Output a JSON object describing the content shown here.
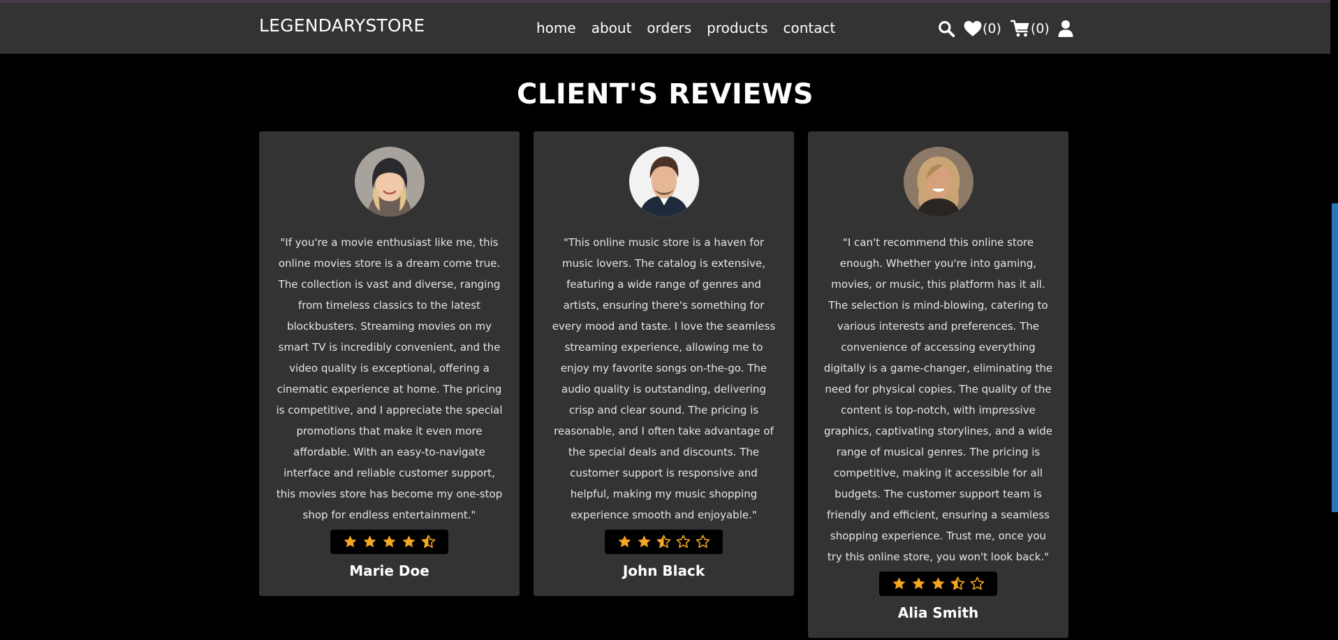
{
  "header": {
    "logo": "LEGENDARYSTORE",
    "nav": [
      {
        "label": "home"
      },
      {
        "label": "about"
      },
      {
        "label": "orders"
      },
      {
        "label": "products"
      },
      {
        "label": "contact"
      }
    ],
    "wishlist_count": "(0)",
    "cart_count": "(0)",
    "icons": [
      "search-icon",
      "heart-icon",
      "cart-icon",
      "user-icon"
    ]
  },
  "section": {
    "title": "CLIENT'S REVIEWS"
  },
  "colors": {
    "background": "#000000",
    "header_bg": "#333333",
    "card_bg": "#333333",
    "star": "#f5a623",
    "scroll_accent": "#2a77b8"
  },
  "reviews": [
    {
      "text": "\"If you're a movie enthusiast like me, this online movies store is a dream come true. The collection is vast and diverse, ranging from timeless classics to the latest blockbusters. Streaming movies on my smart TV is incredibly convenient, and the video quality is exceptional, offering a cinematic experience at home. The pricing is competitive, and I appreciate the special promotions that make it even more affordable. With an easy-to-navigate interface and reliable customer support, this movies store has become my one-stop shop for endless entertainment.\"",
      "rating": 4.5,
      "name": "Marie Doe"
    },
    {
      "text": "\"This online music store is a haven for music lovers. The catalog is extensive, featuring a wide range of genres and artists, ensuring there's something for every mood and taste. I love the seamless streaming experience, allowing me to enjoy my favorite songs on-the-go. The audio quality is outstanding, delivering crisp and clear sound. The pricing is reasonable, and I often take advantage of the special deals and discounts. The customer support is responsive and helpful, making my music shopping experience smooth and enjoyable.\"",
      "rating": 2.5,
      "name": "John Black"
    },
    {
      "text": "\"I can't recommend this online store enough. Whether you're into gaming, movies, or music, this platform has it all. The selection is mind-blowing, catering to various interests and preferences. The convenience of accessing everything digitally is a game-changer, eliminating the need for physical copies. The quality of the content is top-notch, with impressive graphics, captivating storylines, and a wide range of musical genres. The pricing is competitive, making it accessible for all budgets. The customer support team is friendly and efficient, ensuring a seamless shopping experience. Trust me, once you try this online store, you won't look back.\"",
      "rating": 3.5,
      "name": "Alia Smith"
    }
  ]
}
